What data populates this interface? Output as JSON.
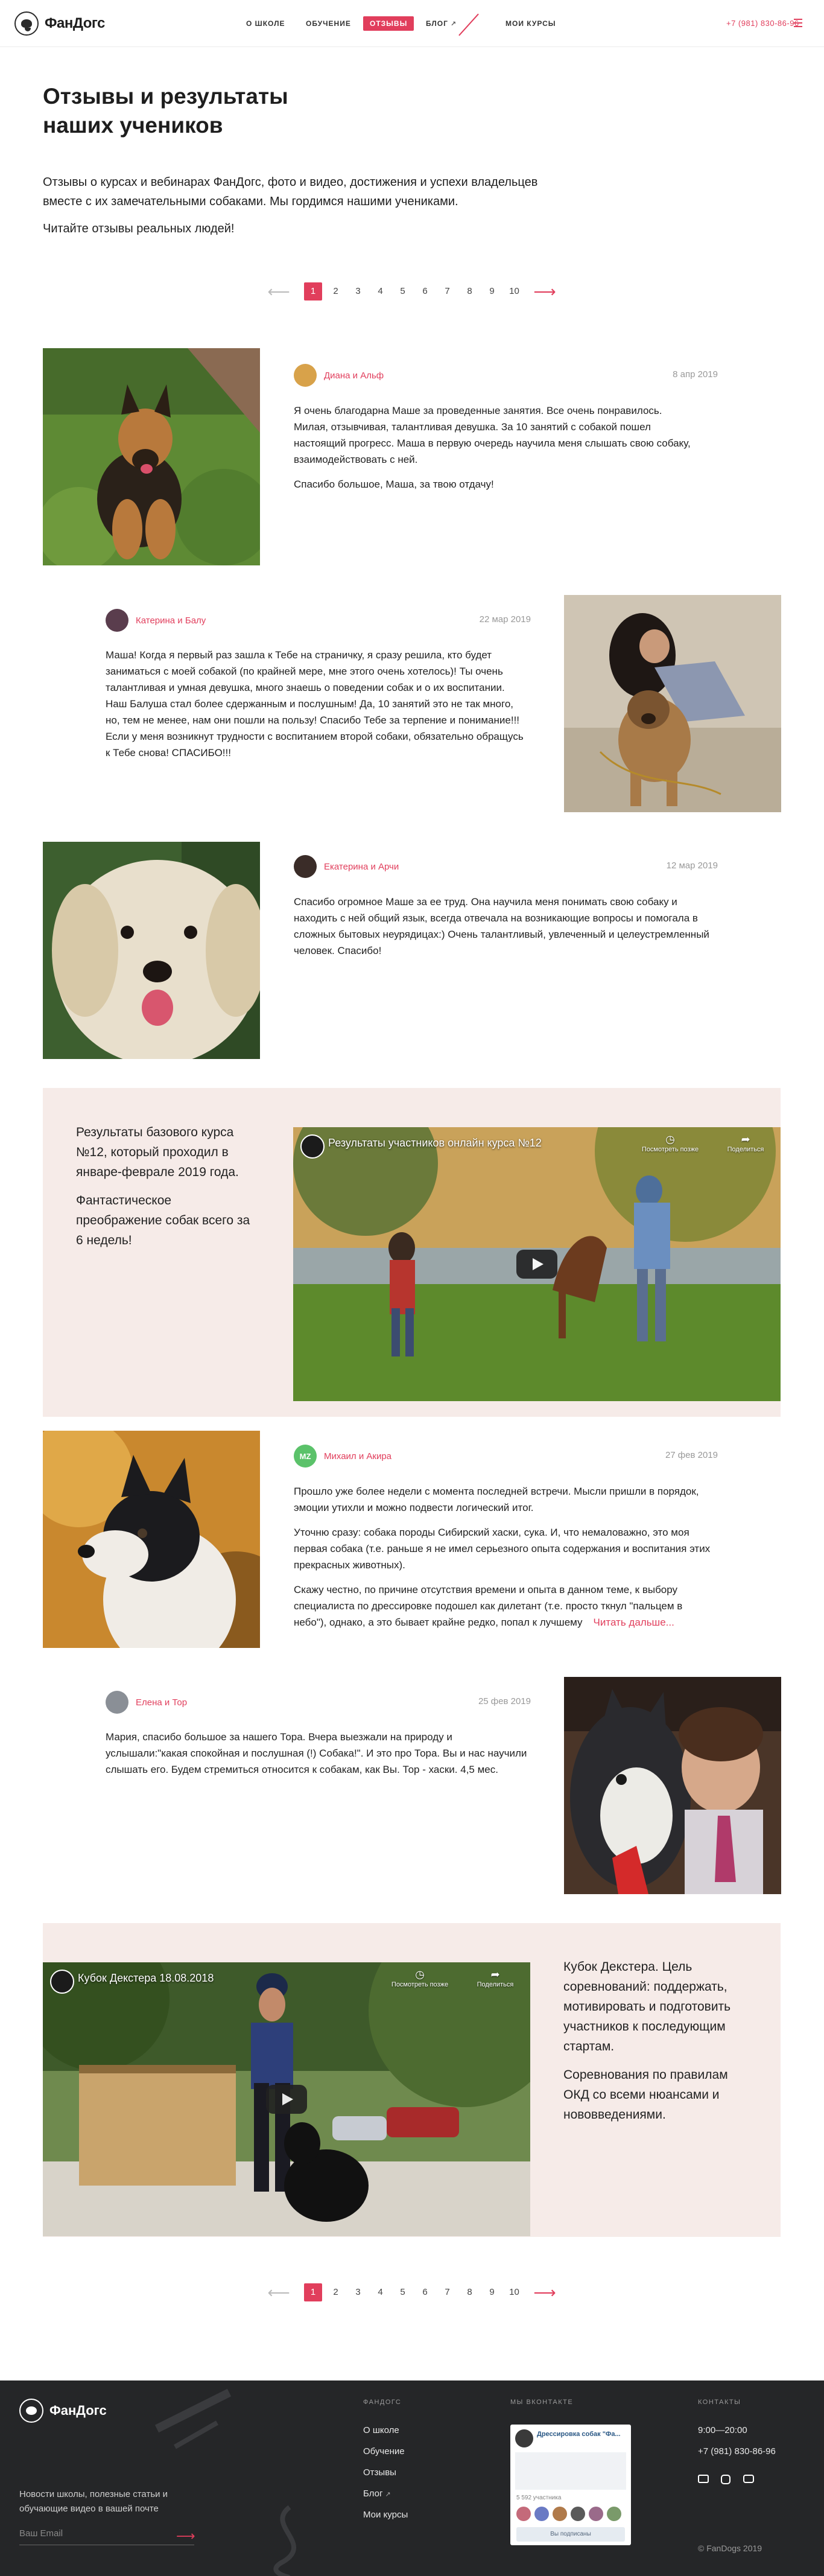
{
  "header": {
    "logo_text": "ФанДогс",
    "nav": {
      "about": "О школе",
      "education": "Обучение",
      "reviews": "Отзывы",
      "blog": "Блог",
      "courses": "Мои курсы"
    },
    "phone": "+7 (981) 830-86-96",
    "accent_color": "#e13e5c",
    "icons": [
      "logo-dog-icon",
      "external-link-icon",
      "menu-icon"
    ]
  },
  "intro": {
    "title": "Отзывы и результаты наших учеников",
    "lead": "Отзывы о курсах и вебинарах ФанДогс, фото и видео, достижения и успехи владельцев вместе с их замечательными собаками. Мы гордимся нашими учениками.",
    "lead2": "Читайте отзывы реальных людей!"
  },
  "pagination": {
    "prev": "⟵",
    "next": "⟶",
    "pages": [
      "1",
      "2",
      "3",
      "4",
      "5",
      "6",
      "7",
      "8",
      "9",
      "10"
    ],
    "current": "1"
  },
  "reviews": [
    {
      "name": "Диана и Альф",
      "date": "8 апр 2019",
      "paragraphs": [
        "Я очень благодарна Маше за проведенные занятия. Все очень понравилось. Милая, отзывчивая, талантливая девушка. За 10 занятий с собакой пошел настоящий прогресс. Маша в первую очередь научила меня слышать свою собаку, взаимодействовать с ней.",
        "Спасибо большое, Маша, за твою отдачу!"
      ]
    },
    {
      "name": "Катерина и Балу",
      "date": "22 мар 2019",
      "paragraphs": [
        "Маша! Когда я первый раз зашла к Тебе на страничку, я сразу решила, кто будет заниматься с моей собакой (по крайней мере, мне этого очень хотелось)! Ты очень талантливая и умная девушка, много знаешь о поведении собак и о их воспитании. Наш Балуша стал более сдержанным и послушным! Да, 10 занятий это не так много, но, тем не менее, нам они пошли на пользу! Спасибо Тебе за терпение и понимание!!! Если у меня возникнут трудности с воспитанием второй собаки, обязательно обращусь к Тебе снова! СПАСИБО!!!"
      ]
    },
    {
      "name": "Екатерина и Арчи",
      "date": "12 мар 2019",
      "paragraphs": [
        "Спасибо огромное Маше за ее труд. Она научила меня понимать свою собаку и находить с ней общий язык, всегда отвечала на возникающие вопросы и помогала в сложных бытовых неурядицах:) Очень талантливый, увлеченный и целеустремленный человек. Спасибо!"
      ]
    },
    {
      "name": "Михаил и Акира",
      "avatar_initials": "MZ",
      "date": "27 фев 2019",
      "paragraphs": [
        "Прошло уже более недели с момента последней встречи. Мысли пришли в порядок, эмоции утихли и можно подвести логический итог.",
        "Уточню сразу: собака породы Сибирский хаски, сука. И, что немаловажно, это моя первая собака (т.е. раньше я не имел серьезного опыта содержания и воспитания этих прекрасных животных).",
        "Скажу честно, по причине отсутствия времени и опыта в данном теме, к выбору специалиста по дрессировке подошел как дилетант (т.е. просто ткнул \"пальцем в небо\"), однако, а это бывает крайне редко, попал к лучшему"
      ],
      "more": "Читать дальше..."
    },
    {
      "name": "Елена и Тор",
      "date": "25 фев 2019",
      "paragraphs": [
        "Мария, спасибо большое за нашего Тора. Вчера выезжали на природу и услышали:\"какая спокойная и послушная (!) Собака!\". И это про Тора. Вы и нас научили слышать его. Будем стремиться относится к собакам, как Вы. Тор - хаски. 4,5 мес."
      ]
    }
  ],
  "promos": [
    {
      "paragraphs": [
        "Результаты базового курса №12, который проходил в январе-феврале 2019 года.",
        "Фантастическое преображение собак всего за 6 недель!"
      ],
      "video_title": "Результаты участников онлайн курса №12",
      "watch_later": "Посмотреть позже",
      "share": "Поделиться"
    },
    {
      "paragraphs": [
        "Кубок Декстера. Цель соревнований: поддержать, мотивировать и подготовить участников к последующим стартам.",
        "Соревнования по правилам ОКД со всеми нюансами и нововведениями."
      ],
      "video_title": "Кубок Декстера 18.08.2018",
      "watch_later": "Посмотреть позже",
      "share": "Поделиться"
    }
  ],
  "footer": {
    "logo_text": "ФанДогс",
    "newsletter_text": "Новости школы, полезные статьи и обучающие видео в вашей почте",
    "email_placeholder": "Ваш Email",
    "col_fundogs_title": "ФанДогс",
    "links": [
      "О школе",
      "Обучение",
      "Отзывы",
      "Блог",
      "Мои курсы"
    ],
    "col_vk_title": "Мы ВКонтакте",
    "vk_group": "Дрессировка собак \"Фа...",
    "vk_members": "5 592 участника",
    "vk_subscribe": "Вы подписаны",
    "col_contacts_title": "Контакты",
    "hours": "9:00—20:00",
    "phone": "+7 (981) 830-86-96",
    "social_icons": [
      "mail-icon",
      "instagram-icon",
      "youtube-icon"
    ],
    "copyright": "© FanDogs 2019"
  }
}
